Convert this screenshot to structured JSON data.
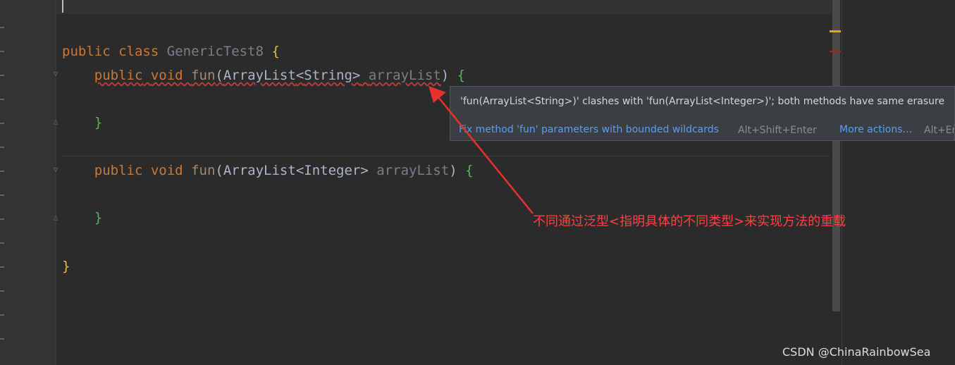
{
  "editor": {
    "lines": {
      "class_decl": {
        "kw1": "public",
        "kw2": "class",
        "name": "GenericTest8",
        "brace": "{"
      },
      "method1": {
        "kw1": "public",
        "kw2": "void",
        "name": "fun",
        "open": "(",
        "type": "ArrayList",
        "lt": "<",
        "generic": "String",
        "gt": ">",
        "param": "arrayList",
        "close": ")",
        "brace": "{"
      },
      "method1_close": "}",
      "method2": {
        "kw1": "public",
        "kw2": "void",
        "name": "fun",
        "open": "(",
        "type": "ArrayList",
        "lt": "<",
        "generic": "Integer",
        "gt": ">",
        "param": "arrayList",
        "close": ")",
        "brace": "{"
      },
      "method2_close": "}",
      "class_close": "}"
    }
  },
  "tooltip": {
    "message": "'fun(ArrayList<String>)' clashes with 'fun(ArrayList<Integer>)'; both methods have same erasure",
    "fix_action": "Fix method 'fun' parameters with bounded wildcards",
    "fix_shortcut": "Alt+Shift+Enter",
    "more_actions": "More actions...",
    "more_shortcut": "Alt+Enter"
  },
  "annotation": {
    "text": "不同通过泛型<指明具体的不同类型>来实现方法的重载",
    "color": "#ff4040"
  },
  "watermark": "CSDN @ChinaRainbowSea",
  "colors": {
    "background": "#2b2b2b",
    "keyword": "#cc7832",
    "error": "#bc3f3c",
    "link": "#589df6"
  }
}
